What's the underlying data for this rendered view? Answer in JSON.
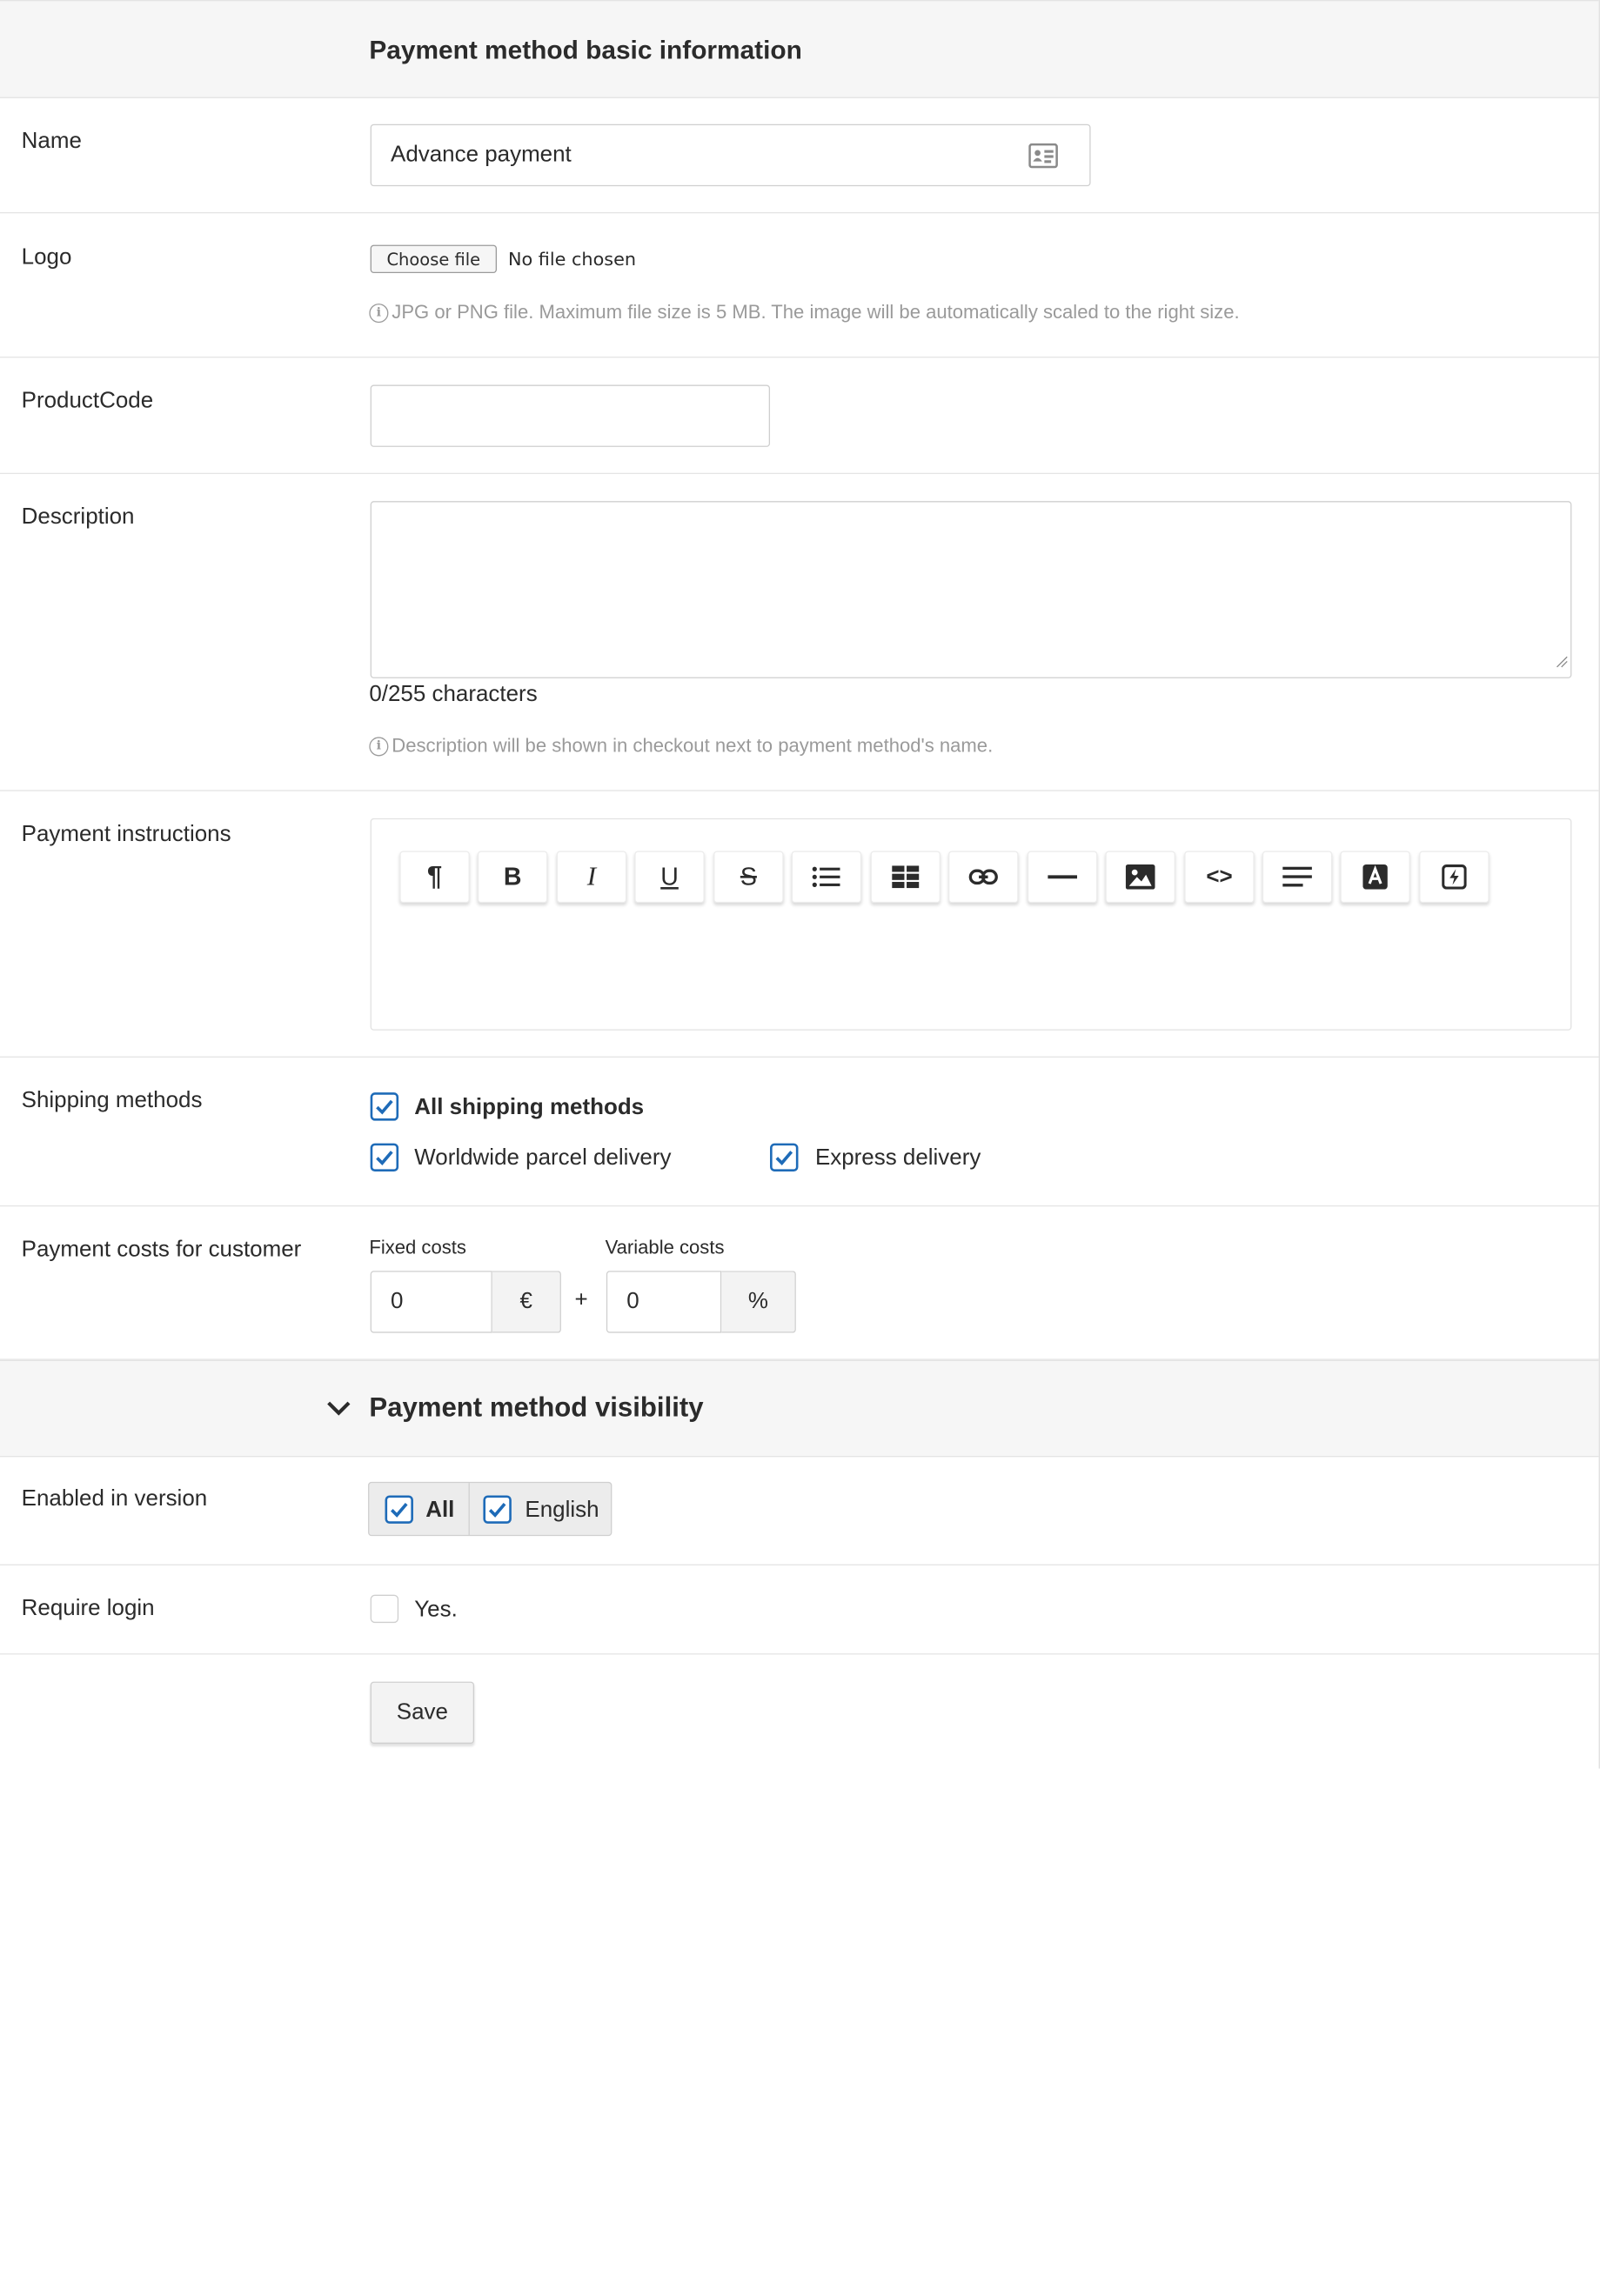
{
  "basic_info": {
    "title": "Payment method basic information"
  },
  "name_field": {
    "label": "Name",
    "value": "Advance payment",
    "icon": "address-card-icon"
  },
  "logo_field": {
    "label": "Logo",
    "choose_button": "Choose file",
    "file_status": "No file chosen",
    "help": "JPG or PNG file. Maximum file size is 5 MB. The image will be automatically scaled to the right size."
  },
  "product_code": {
    "label": "ProductCode",
    "value": ""
  },
  "description": {
    "label": "Description",
    "value": "",
    "counter": "0/255 characters",
    "help": "Description will be shown in checkout next to payment method's name."
  },
  "payment_instructions": {
    "label": "Payment instructions",
    "toolbar": [
      {
        "name": "paragraph",
        "icon": "paragraph-icon",
        "glyph": "¶"
      },
      {
        "name": "bold",
        "icon": "bold-icon",
        "glyph": "B"
      },
      {
        "name": "italic",
        "icon": "italic-icon",
        "glyph": "I"
      },
      {
        "name": "underline",
        "icon": "underline-icon",
        "glyph": "U"
      },
      {
        "name": "strikethrough",
        "icon": "strikethrough-icon",
        "glyph": "S"
      },
      {
        "name": "list",
        "icon": "list-icon",
        "glyph": "list"
      },
      {
        "name": "table",
        "icon": "table-icon",
        "glyph": "table"
      },
      {
        "name": "link",
        "icon": "link-icon",
        "glyph": "link"
      },
      {
        "name": "horizontal-rule",
        "icon": "horizontal-rule-icon",
        "glyph": "hr"
      },
      {
        "name": "image",
        "icon": "image-icon",
        "glyph": "img"
      },
      {
        "name": "code",
        "icon": "code-icon",
        "glyph": "<>"
      },
      {
        "name": "align",
        "icon": "align-icon",
        "glyph": "align"
      },
      {
        "name": "font-color",
        "icon": "font-color-icon",
        "glyph": "A"
      },
      {
        "name": "special",
        "icon": "lightning-icon",
        "glyph": "bolt"
      }
    ]
  },
  "shipping_methods": {
    "label": "Shipping methods",
    "all": {
      "label": "All shipping methods",
      "checked": true
    },
    "options": [
      {
        "label": "Worldwide parcel delivery",
        "checked": true
      },
      {
        "label": "Express delivery",
        "checked": true
      }
    ]
  },
  "payment_costs": {
    "label": "Payment costs for customer",
    "fixed_label": "Fixed costs",
    "fixed_value": "0",
    "fixed_unit": "€",
    "plus": "+",
    "variable_label": "Variable costs",
    "variable_value": "0",
    "variable_unit": "%"
  },
  "visibility": {
    "title": "Payment method visibility"
  },
  "enabled_in_version": {
    "label": "Enabled in version",
    "options": [
      {
        "label": "All",
        "checked": true
      },
      {
        "label": "English",
        "checked": true
      }
    ]
  },
  "require_login": {
    "label": "Require login",
    "option_label": "Yes.",
    "checked": false
  },
  "actions": {
    "save_label": "Save"
  },
  "colors": {
    "accent": "#1e6bb8",
    "section_bg": "#f6f6f6",
    "border": "#e4e4e4",
    "help_text": "#9a9a9a"
  }
}
